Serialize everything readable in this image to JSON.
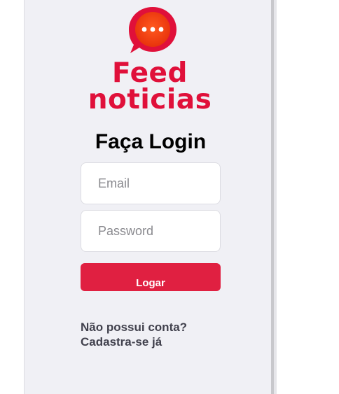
{
  "brand": {
    "logo_icon": "chat-bubble-ellipsis-icon",
    "name_line1": "Feed",
    "name_line2": "noticias",
    "color": "#e0103a"
  },
  "login": {
    "title": "Faça Login",
    "email_placeholder": "Email",
    "password_placeholder": "Password",
    "submit_label": "Logar",
    "button_color": "#e02041"
  },
  "signup": {
    "line1": "Não possui conta?",
    "line2": "Cadastra-se já"
  }
}
